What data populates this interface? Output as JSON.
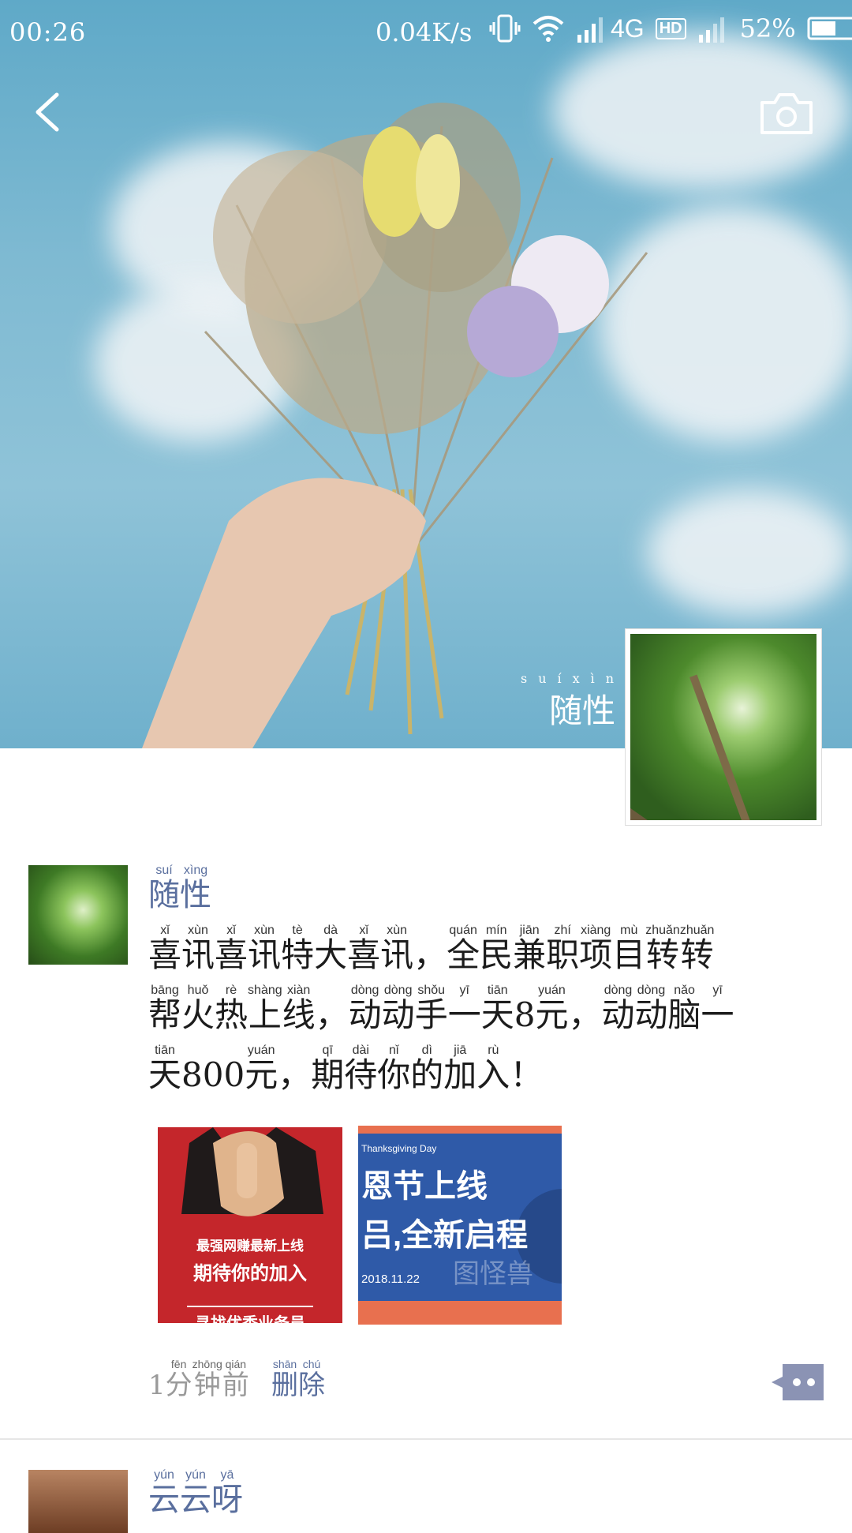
{
  "status_bar": {
    "time": "00:26",
    "speed": "0.04K/s",
    "network": "4G",
    "hd": "HD",
    "battery": "52%"
  },
  "cover": {
    "caption_pinyin": [
      "suí",
      "xìng"
    ],
    "caption": "随性"
  },
  "post": {
    "username": [
      [
        "随",
        "suí"
      ],
      [
        "性",
        "xìng"
      ]
    ],
    "text_lines": [
      [
        [
          "喜",
          "xǐ"
        ],
        [
          "讯",
          "xùn"
        ],
        [
          "喜",
          "xǐ"
        ],
        [
          "讯",
          "xùn"
        ],
        [
          "特",
          "tè"
        ],
        [
          "大",
          "dà"
        ],
        [
          "喜",
          "xǐ"
        ],
        [
          "讯",
          "xùn"
        ],
        [
          "，",
          ""
        ],
        [
          "全",
          "quán"
        ],
        [
          "民",
          "mín"
        ],
        [
          "兼",
          "jiān"
        ],
        [
          "职",
          "zhí"
        ],
        [
          "项",
          "xiàng"
        ],
        [
          "目",
          "mù"
        ],
        [
          "转",
          "zhuǎn"
        ],
        [
          "转",
          "zhuǎn"
        ]
      ],
      [
        [
          "帮",
          "bāng"
        ],
        [
          "火",
          "huǒ"
        ],
        [
          "热",
          "rè"
        ],
        [
          "上",
          "shàng"
        ],
        [
          "线",
          "xiàn"
        ],
        [
          "，",
          ""
        ],
        [
          "动",
          "dòng"
        ],
        [
          "动",
          "dòng"
        ],
        [
          "手",
          "shǒu"
        ],
        [
          "一",
          "yī"
        ],
        [
          "天",
          "tiān"
        ],
        [
          "8",
          ""
        ],
        [
          "元",
          "yuán"
        ],
        [
          "，",
          ""
        ],
        [
          "动",
          "dòng"
        ],
        [
          "动",
          "dòng"
        ],
        [
          "脑",
          "nǎo"
        ],
        [
          "一",
          "yī"
        ]
      ],
      [
        [
          "天",
          "tiān"
        ],
        [
          "800",
          ""
        ],
        [
          "元",
          "yuán"
        ],
        [
          "，",
          ""
        ],
        [
          "期",
          "qī"
        ],
        [
          "待",
          "dài"
        ],
        [
          "你",
          "nǐ"
        ],
        [
          "的",
          "dì"
        ],
        [
          "加",
          "jiā"
        ],
        [
          "入",
          "rù"
        ],
        [
          "！",
          ""
        ]
      ]
    ],
    "image1": {
      "line1": "最强网赚最新上线",
      "line2": "期待你的加入",
      "line3": "寻找优秀业务员"
    },
    "image2": {
      "tag": "Thanksgiving Day",
      "line1": "恩节上线",
      "line2": "吕,全新启程",
      "date": "2018.11.22",
      "watermark": "图怪兽"
    },
    "time_ago": [
      [
        "1",
        ""
      ],
      [
        "分",
        "fēn"
      ],
      [
        "钟",
        "zhōng"
      ],
      [
        "前",
        "qián"
      ]
    ],
    "delete": [
      [
        "删",
        "shān"
      ],
      [
        "除",
        "chú"
      ]
    ]
  },
  "next_post": {
    "username": [
      [
        "云",
        "yún"
      ],
      [
        "云",
        "yún"
      ],
      [
        "呀",
        "yā"
      ]
    ]
  }
}
